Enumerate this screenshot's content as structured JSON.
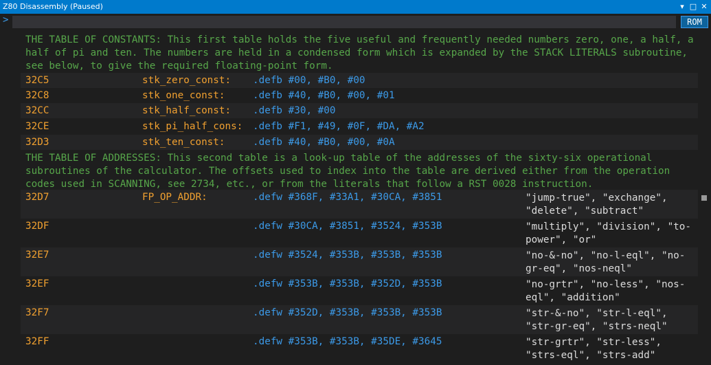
{
  "window": {
    "title": "Z80 Disassembly (Paused)",
    "controls": [
      "▾",
      "□",
      "✕"
    ]
  },
  "toolbar": {
    "prompt": ">",
    "command_value": "",
    "rom_label": "ROM"
  },
  "listing": [
    {
      "type": "comment",
      "text": "THE TABLE OF CONSTANTS: This first table holds the five useful and frequently needed numbers zero, one, a half, a half of pi and ten. The numbers are held in a condensed form which is expanded by the STACK LITERALS subroutine, see below, to give the required floating-point form."
    },
    {
      "type": "code",
      "addr": "32C5",
      "label": "stk_zero_const:",
      "op": ".defb #00, #B0, #00",
      "cmt": ""
    },
    {
      "type": "code",
      "addr": "32C8",
      "label": "stk_one_const:",
      "op": ".defb #40, #B0, #00, #01",
      "cmt": ""
    },
    {
      "type": "code",
      "addr": "32CC",
      "label": "stk_half_const:",
      "op": ".defb #30, #00",
      "cmt": ""
    },
    {
      "type": "code",
      "addr": "32CE",
      "label": "stk_pi_half_cons:",
      "op": ".defb #F1, #49, #0F, #DA, #A2",
      "cmt": ""
    },
    {
      "type": "code",
      "addr": "32D3",
      "label": "stk_ten_const:",
      "op": ".defb #40, #B0, #00, #0A",
      "cmt": ""
    },
    {
      "type": "comment",
      "text": "THE TABLE OF ADDRESSES: This second table is a look-up table of the addresses of the sixty-six operational subroutines of the calculator. The offsets used to index into the table are derived either from the operation codes used in SCANNING, see 2734, etc., or from the literals that follow a RST 0028 instruction."
    },
    {
      "type": "code",
      "addr": "32D7",
      "label": "FP_OP_ADDR:",
      "op": ".defw #368F, #33A1, #30CA, #3851",
      "cmt": "\"jump-true\", \"exchange\", \"delete\", \"subtract\""
    },
    {
      "type": "code",
      "addr": "32DF",
      "label": "",
      "op": ".defw #30CA, #3851, #3524, #353B",
      "cmt": "\"multiply\", \"division\", \"to-power\", \"or\""
    },
    {
      "type": "code",
      "addr": "32E7",
      "label": "",
      "op": ".defw #3524, #353B, #353B, #353B",
      "cmt": "\"no-&-no\", \"no-l-eql\", \"no-gr-eq\", \"nos-neql\""
    },
    {
      "type": "code",
      "addr": "32EF",
      "label": "",
      "op": ".defw #353B, #353B, #352D, #353B",
      "cmt": "\"no-grtr\", \"no-less\", \"nos-eql\", \"addition\""
    },
    {
      "type": "code",
      "addr": "32F7",
      "label": "",
      "op": ".defw #352D, #353B, #353B, #353B",
      "cmt": "\"str-&-no\", \"str-l-eql\", \"str-gr-eq\", \"strs-neql\""
    },
    {
      "type": "code",
      "addr": "32FF",
      "label": "",
      "op": ".defw #353B, #353B, #35DE, #3645",
      "cmt": "\"str-grtr\", \"str-less\", \"strs-eql\", \"strs-add\""
    }
  ],
  "colors": {
    "title_bar": "#007acc",
    "background": "#1e1e1e",
    "alt_row": "#252526",
    "comment": "#57a64a",
    "address": "#f0a030",
    "operand": "#3c9ae8",
    "note": "#dcdcdc"
  }
}
